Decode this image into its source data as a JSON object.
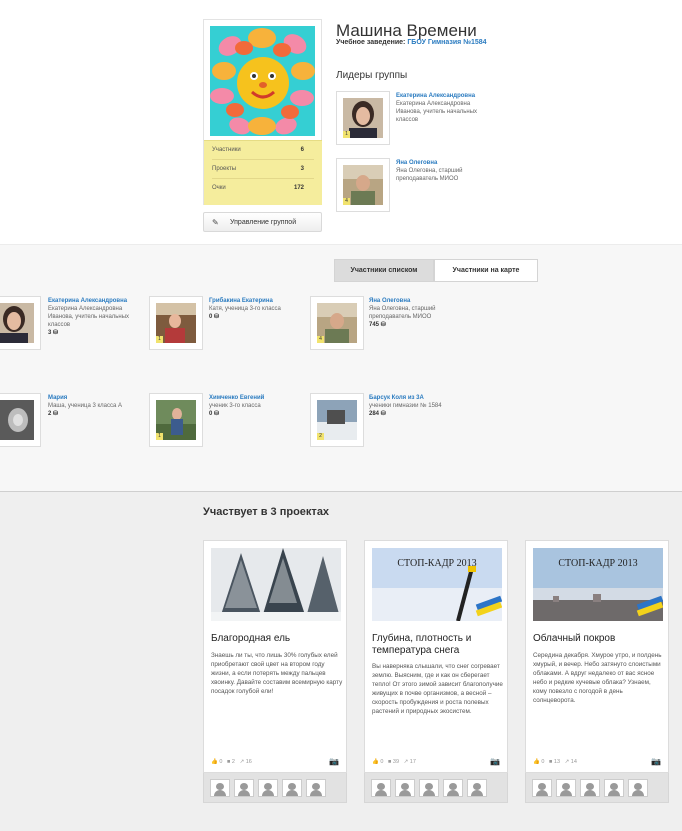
{
  "group": {
    "title": "Машина Времени",
    "school_label": "Учебное заведение:",
    "school_link": "ГБОУ Гимназия №1584",
    "stats": [
      {
        "label": "Участники",
        "value": "6"
      },
      {
        "label": "Проекты",
        "value": "3"
      },
      {
        "label": "Очки",
        "value": "172"
      }
    ],
    "manage_button": "Управление группой",
    "leaders_title": "Лидеры группы",
    "leaders": [
      {
        "name": "Екатерина Александровна",
        "desc": "Екатерина Александровна Иванова, учитель начальных классов",
        "badge": "1"
      },
      {
        "name": "Яна Олеговна",
        "desc": "Яна Олеговна, старший преподаватель МИОО",
        "badge": "4"
      }
    ]
  },
  "tabs": {
    "list": "Участники списком",
    "map": "Участники на карте"
  },
  "members": [
    {
      "name": "Екатерина Александровна",
      "desc": "Екатерина Александровна Иванова, учитель начальных классов",
      "points": "3",
      "badge": ""
    },
    {
      "name": "Грибакина Екатерина",
      "desc": "Катя, ученица 3-го класса",
      "points": "0",
      "badge": "1"
    },
    {
      "name": "Яна Олеговна",
      "desc": "Яна Олеговна, старший преподаватель МИОО",
      "points": "745",
      "badge": "4"
    },
    {
      "name": "Мария",
      "desc": "Маша, ученица 3 класса А",
      "points": "2",
      "badge": ""
    },
    {
      "name": "Химченко Евгений",
      "desc": "ученик 3-го класса",
      "points": "0",
      "badge": "1"
    },
    {
      "name": "Барсук Коля из 3А",
      "desc": "ученики гимназии № 1584",
      "points": "284",
      "badge": "2"
    }
  ],
  "projects_title": "Участвует в 3 проектах",
  "projects": [
    {
      "title": "Благородная ель",
      "desc": "Знаешь ли ты, что лишь 30% голубых елей приобретают свой цвет на втором году жизни, а если потерять между пальцев хвоинку. Давайте составим всемирную карту посадок голубой ели!",
      "likes": "0",
      "comments": "2",
      "views": "16",
      "banner": ""
    },
    {
      "title": "Глубина, плотность и температура снега",
      "desc": "Вы наверняка слышали, что снег согревает землю. Выясним, где и как он сберегает тепло! От этого зимой зависит благополучие живущих в почве организмов, а весной – скорость пробуждения и роста полевых растений и природных экосистем.",
      "likes": "0",
      "comments": "39",
      "views": "17",
      "banner": "СТОП-КАДР 2013"
    },
    {
      "title": "Облачный покров",
      "desc": "Середина декабря. Хмурое утро, и полдень хмурый, и вечер. Небо затянуто слоистыми облаками. А вдруг недалеко от вас ясное небо и редкие кучевые облака? Узнаем, кому повезло с погодой в день солнцеворота.",
      "likes": "0",
      "comments": "13",
      "views": "14",
      "banner": "СТОП-КАДР 2013"
    }
  ],
  "colors": {
    "link": "#2a7bc0",
    "stats_bg": "#f5ed9d"
  },
  "icons": [
    "pencil-icon",
    "coin-icon",
    "like-icon",
    "comment-icon",
    "chart-icon",
    "camera-icon",
    "user-avatar-icon"
  ]
}
